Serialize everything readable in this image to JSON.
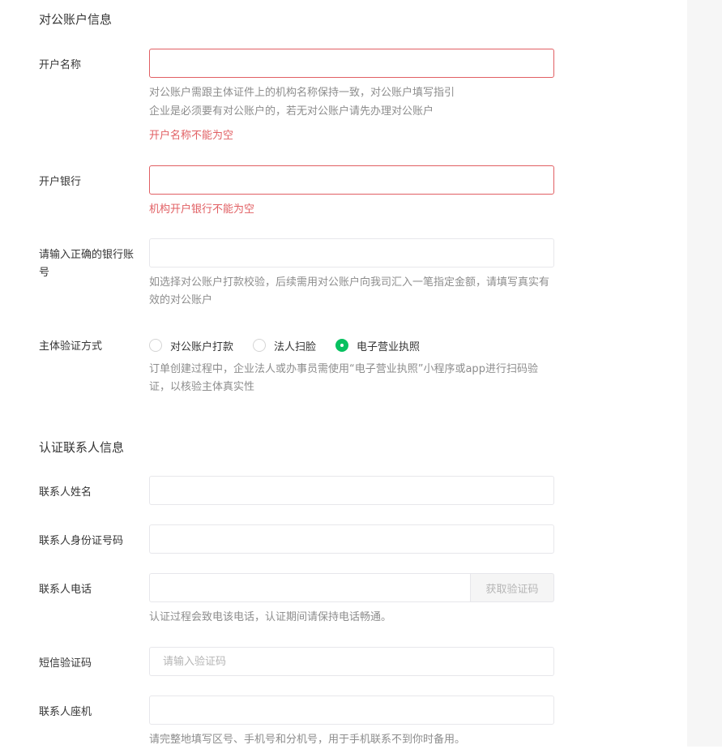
{
  "sections": {
    "public_account_title": "对公账户信息",
    "contact_title": "认证联系人信息"
  },
  "account_name": {
    "label": "开户名称",
    "value": "",
    "hint_line1": "对公账户需跟主体证件上的机构名称保持一致，对公账户填写指引",
    "hint_line2": "企业是必须要有对公账户的，若无对公账户请先办理对公账户",
    "error": "开户名称不能为空"
  },
  "bank": {
    "label": "开户银行",
    "value": "",
    "error": "机构开户银行不能为空"
  },
  "bank_account": {
    "label": "请输入正确的银行账号",
    "value": "",
    "hint": "如选择对公账户打款校验，后续需用对公账户向我司汇入一笔指定金额，请填写真实有效的对公账户"
  },
  "verification": {
    "label": "主体验证方式",
    "options": [
      "对公账户打款",
      "法人扫脸",
      "电子营业执照"
    ],
    "selected_index": 2,
    "hint": "订单创建过程中，企业法人或办事员需使用“电子营业执照”小程序或app进行扫码验证，以核验主体真实性"
  },
  "contact_name": {
    "label": "联系人姓名",
    "value": ""
  },
  "contact_id": {
    "label": "联系人身份证号码",
    "value": ""
  },
  "contact_phone": {
    "label": "联系人电话",
    "value": "",
    "code_button": "获取验证码",
    "hint": "认证过程会致电该电话，认证期间请保持电话畅通。"
  },
  "sms_code": {
    "label": "短信验证码",
    "placeholder": "请输入验证码"
  },
  "landline": {
    "label": "联系人座机",
    "value": "",
    "hint": "请完整地填写区号、手机号和分机号，用于手机联系不到你时备用。"
  },
  "colors": {
    "error": "#e15f63",
    "accent": "#07c160",
    "hint": "#8d8d8d"
  }
}
